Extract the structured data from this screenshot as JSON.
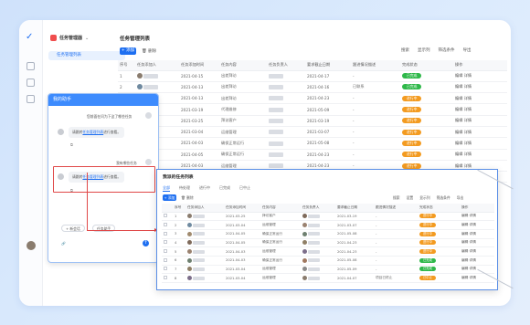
{
  "main": {
    "title": "任务管理列表",
    "add_button": "+ 添加",
    "delete_button": "删除",
    "tools": [
      "搜索",
      "显示列",
      "筛选条件",
      "导出"
    ],
    "columns": [
      "序号",
      "任务添加人",
      "任务添加时间",
      "任务内容",
      "任务负责人",
      "要求截止日期",
      "跟进情况描述",
      "完成状态",
      "操作"
    ],
    "rows": [
      {
        "no": "1",
        "date": "2021-04-15",
        "content": "出差拜访",
        "deadline": "2021-04-17",
        "follow": "-",
        "status": "已完成",
        "status_color": "green",
        "ops": "编辑  详情"
      },
      {
        "no": "2",
        "date": "2021-04-13",
        "content": "出差拜访",
        "deadline": "2021-04-16",
        "follow": "已联系",
        "status": "已完成",
        "status_color": "green",
        "ops": "编辑  详情"
      },
      {
        "no": "3",
        "date": "2021-04-13",
        "content": "出差拜访",
        "deadline": "2021-04-23",
        "follow": "-",
        "status": "进行中",
        "status_color": "orange",
        "ops": "编辑  详情"
      },
      {
        "no": "4",
        "date": "2021-03-19",
        "content": "代理维修",
        "deadline": "2021-05-09",
        "follow": "-",
        "status": "进行中",
        "status_color": "orange",
        "ops": "编辑  详情"
      },
      {
        "no": "5",
        "date": "2021-03-25",
        "content": "拜访客户",
        "deadline": "2021-03-19",
        "follow": "-",
        "status": "进行中",
        "status_color": "orange",
        "ops": "编辑  详情"
      },
      {
        "no": "6",
        "date": "2021-03-04",
        "content": "运维管理",
        "deadline": "2021-03-07",
        "follow": "-",
        "status": "进行中",
        "status_color": "orange",
        "ops": "编辑  详情"
      },
      {
        "no": "7",
        "date": "2021-04-03",
        "content": "确保正常运行",
        "deadline": "2021-05-08",
        "follow": "-",
        "status": "进行中",
        "status_color": "orange",
        "ops": "编辑  详情"
      },
      {
        "no": "8",
        "date": "2021-04-05",
        "content": "确保正常运行",
        "deadline": "2021-04-23",
        "follow": "-",
        "status": "进行中",
        "status_color": "orange",
        "ops": "编辑  详情"
      },
      {
        "no": "9",
        "date": "2021-04-03",
        "content": "运维管理",
        "deadline": "2021-04-23",
        "follow": "-",
        "status": "进行中",
        "status_color": "orange",
        "ops": "编辑  详情"
      },
      {
        "no": "10",
        "date": "2021-04-05",
        "content": "",
        "deadline": "",
        "follow": "",
        "status": "",
        "status_color": "",
        "ops": ""
      }
    ]
  },
  "sidebar": {
    "header": "任务管理器",
    "item": "任务管理列表"
  },
  "chat": {
    "title": "我的助手",
    "greeting": "您前面在问为下这了哪些任务",
    "msg1_prefix": "请跳转",
    "msg1_link": "任务管理列表",
    "msg1_suffix": "进行查看。",
    "query2": "我有哪些任务",
    "msg2_prefix": "请跳转",
    "msg2_link": "任务管理列表",
    "msg2_suffix": "进行查看。",
    "new_chat": "+ 新会话",
    "assistant_btn": "任务助手"
  },
  "overlay": {
    "title": "我派的任务列表",
    "tabs": [
      "全部",
      "待处理",
      "进行中",
      "已完成",
      "已中止"
    ],
    "add_button": "+ 添加",
    "delete_button": "删除",
    "tools": [
      "搜索",
      "设置",
      "显示列",
      "筛选条件",
      "导出"
    ],
    "columns": [
      "",
      "序号",
      "任务添加人",
      "任务添加时间",
      "任务内容",
      "任务负责人",
      "要求截止日期",
      "跟进情况描述",
      "完成状态",
      "操作"
    ],
    "rows": [
      {
        "no": "1",
        "date": "2021-03-25",
        "content": "拜访客户",
        "deadline": "2021-03-19",
        "follow": "-",
        "status": "进行中",
        "status_color": "orange",
        "ops": "编辑  详情"
      },
      {
        "no": "2",
        "date": "2021-03-04",
        "content": "运维管理",
        "deadline": "2021-03-07",
        "follow": "-",
        "status": "进行中",
        "status_color": "orange",
        "ops": "编辑  详情"
      },
      {
        "no": "3",
        "date": "2021-04-05",
        "content": "确保正常运行",
        "deadline": "2021-05-08",
        "follow": "-",
        "status": "进行中",
        "status_color": "orange",
        "ops": "编辑  详情"
      },
      {
        "no": "4",
        "date": "2021-04-05",
        "content": "确保正常运行",
        "deadline": "2021-04-23",
        "follow": "-",
        "status": "进行中",
        "status_color": "orange",
        "ops": "编辑  详情"
      },
      {
        "no": "5",
        "date": "2021-04-03",
        "content": "运维管理",
        "deadline": "2021-04-23",
        "follow": "-",
        "status": "进行中",
        "status_color": "orange",
        "ops": "编辑  详情"
      },
      {
        "no": "6",
        "date": "2021-04-03",
        "content": "确保正常运行",
        "deadline": "2021-05-08",
        "follow": "-",
        "status": "已完成",
        "status_color": "green",
        "ops": "编辑  详情"
      },
      {
        "no": "7",
        "date": "2021-03-04",
        "content": "运维管理",
        "deadline": "2021-05-09",
        "follow": "-",
        "status": "已完成",
        "status_color": "green",
        "ops": "编辑  详情"
      },
      {
        "no": "8",
        "date": "2021-03-04",
        "content": "运维管理",
        "deadline": "2021-04-07",
        "follow": "项目已终止",
        "status": "已中止",
        "status_color": "orange",
        "ops": "编辑  详情"
      }
    ]
  }
}
